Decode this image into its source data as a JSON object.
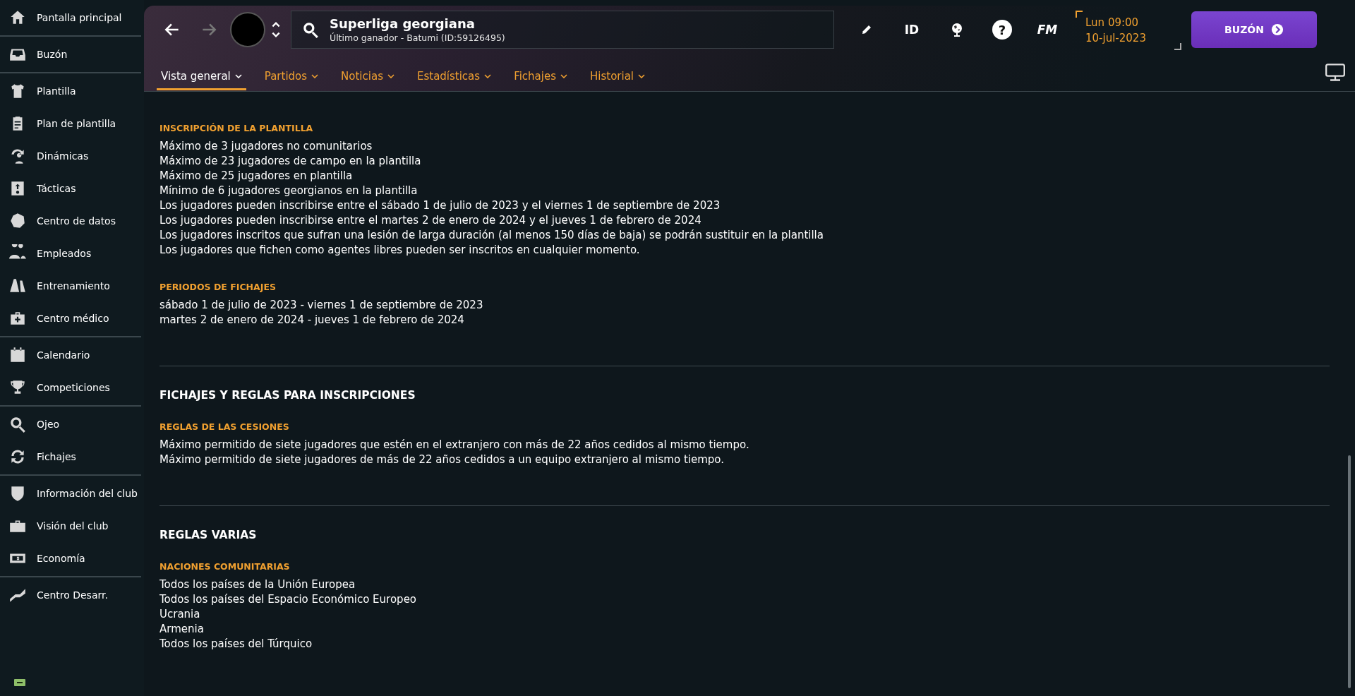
{
  "sidebar": {
    "groups": [
      {
        "items": [
          {
            "label": "Pantalla principal"
          }
        ]
      },
      {
        "items": [
          {
            "label": "Buzón"
          }
        ]
      },
      {
        "items": [
          {
            "label": "Plantilla"
          },
          {
            "label": "Plan de plantilla"
          },
          {
            "label": "Dinámicas"
          },
          {
            "label": "Tácticas"
          },
          {
            "label": "Centro de datos"
          },
          {
            "label": "Empleados"
          },
          {
            "label": "Entrenamiento"
          },
          {
            "label": "Centro médico"
          }
        ]
      },
      {
        "items": [
          {
            "label": "Calendario"
          },
          {
            "label": "Competiciones"
          }
        ]
      },
      {
        "items": [
          {
            "label": "Ojeo"
          },
          {
            "label": "Fichajes"
          }
        ]
      },
      {
        "items": [
          {
            "label": "Información del club"
          },
          {
            "label": "Visión del club"
          },
          {
            "label": "Economía"
          }
        ]
      },
      {
        "items": [
          {
            "label": "Centro Desarr."
          }
        ]
      }
    ]
  },
  "header": {
    "title": "Superliga georgiana",
    "subtitle": "Último ganador - Batumi (ID:59126495)",
    "toolbar": [
      {
        "kind": "edit"
      },
      {
        "kind": "id",
        "label": "ID"
      },
      {
        "kind": "globe"
      },
      {
        "kind": "help",
        "label": "?"
      },
      {
        "kind": "fm",
        "label": "FM"
      }
    ],
    "date": {
      "day_time": "Lun 09:00",
      "date": "10-jul-2023"
    },
    "mailbox_button": "BUZÓN"
  },
  "tabs": [
    {
      "label": "Vista general",
      "selected": true
    },
    {
      "label": "Partidos",
      "selected": false
    },
    {
      "label": "Noticias",
      "selected": false
    },
    {
      "label": "Estadísticas",
      "selected": false
    },
    {
      "label": "Fichajes",
      "selected": false
    },
    {
      "label": "Historial",
      "selected": false
    }
  ],
  "sections": [
    {
      "blocks": [
        {
          "heading": "INSCRIPCIÓN DE LA PLANTILLA",
          "lines": [
            "Máximo de 3 jugadores no comunitarios",
            "Máximo de 23 jugadores de campo en la plantilla",
            "Máximo de 25 jugadores en plantilla",
            "Mínimo de 6 jugadores georgianos en la plantilla",
            "Los jugadores pueden inscribirse entre el sábado 1 de julio de 2023 y el viernes 1 de septiembre de 2023",
            "Los jugadores pueden inscribirse entre el martes 2 de enero de 2024 y el jueves 1 de febrero de 2024",
            "Los jugadores inscritos que sufran una lesión de larga duración (al menos 150 días de baja) se podrán sustituir en la plantilla",
            "Los jugadores que fichen como agentes libres pueden ser inscritos en cualquier momento."
          ]
        },
        {
          "heading": "PERIODOS DE FICHAJES",
          "lines": [
            "sábado 1 de julio de 2023 - viernes 1 de septiembre de 2023",
            "martes 2 de enero de 2024 - jueves 1 de febrero de 2024"
          ]
        }
      ]
    },
    {
      "title": "FICHAJES Y REGLAS PARA INSCRIPCIONES",
      "blocks": [
        {
          "heading": "REGLAS DE LAS CESIONES",
          "lines": [
            "Máximo permitido de siete jugadores que estén en el extranjero con más de 22 años cedidos al mismo tiempo.",
            "Máximo permitido de siete jugadores de más de 22 años cedidos a un equipo extranjero al mismo tiempo."
          ]
        }
      ]
    },
    {
      "title": "REGLAS VARIAS",
      "blocks": [
        {
          "heading": "NACIONES COMUNITARIAS",
          "lines": [
            "Todos los países de la Unión Europea",
            "Todos los países del Espacio Económico Europeo",
            "Ucrania",
            "Armenia",
            "Todos los países del Túrquico"
          ]
        }
      ]
    }
  ]
}
